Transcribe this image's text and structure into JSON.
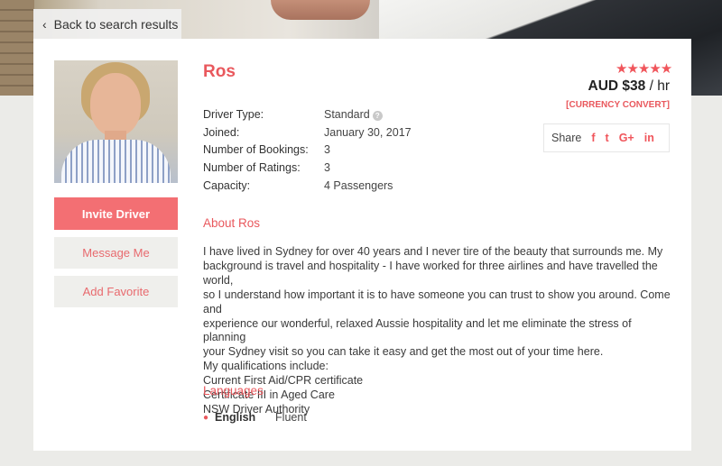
{
  "nav": {
    "back_label": "Back to search results"
  },
  "profile": {
    "name": "Ros",
    "details": [
      {
        "label": "Driver Type:",
        "value": "Standard"
      },
      {
        "label": "Joined:",
        "value": "January 30, 2017"
      },
      {
        "label": "Number of Bookings:",
        "value": "3"
      },
      {
        "label": "Number of Ratings:",
        "value": "3"
      },
      {
        "label": "Capacity:",
        "value": "4 Passengers"
      }
    ],
    "rating_stars": 5,
    "stars_text": "★★★★★",
    "price": {
      "amount": "AUD $38",
      "unit": "/ hr"
    },
    "currency_convert": "[CURRENCY CONVERT]"
  },
  "actions": {
    "invite": "Invite Driver",
    "message": "Message Me",
    "favorite": "Add Favorite"
  },
  "share": {
    "label": "Share",
    "icons": {
      "facebook": "f",
      "twitter": "t",
      "google": "G+",
      "linkedin": "in"
    }
  },
  "about": {
    "title": "About Ros",
    "lines": [
      "I have lived in Sydney for over 40 years and I never tire of the beauty that surrounds me. My",
      "background is travel and hospitality - I have worked for three airlines and have travelled the world,",
      "so I understand how important it is to have someone you can trust to show you around. Come and",
      "experience our wonderful, relaxed Aussie hospitality and let me eliminate the stress of planning",
      "your Sydney visit so you can take it easy and get the most out of your time here.",
      "My qualifications include:",
      "Current First Aid/CPR certificate",
      "Certificate III in Aged Care",
      "NSW Driver Authority"
    ]
  },
  "languages": {
    "title": "Languages",
    "items": [
      {
        "name": "English",
        "level": "Fluent"
      }
    ]
  },
  "colors": {
    "accent": "#f36f73",
    "accent_text": "#e9585d",
    "page_bg": "#ebebe8"
  }
}
